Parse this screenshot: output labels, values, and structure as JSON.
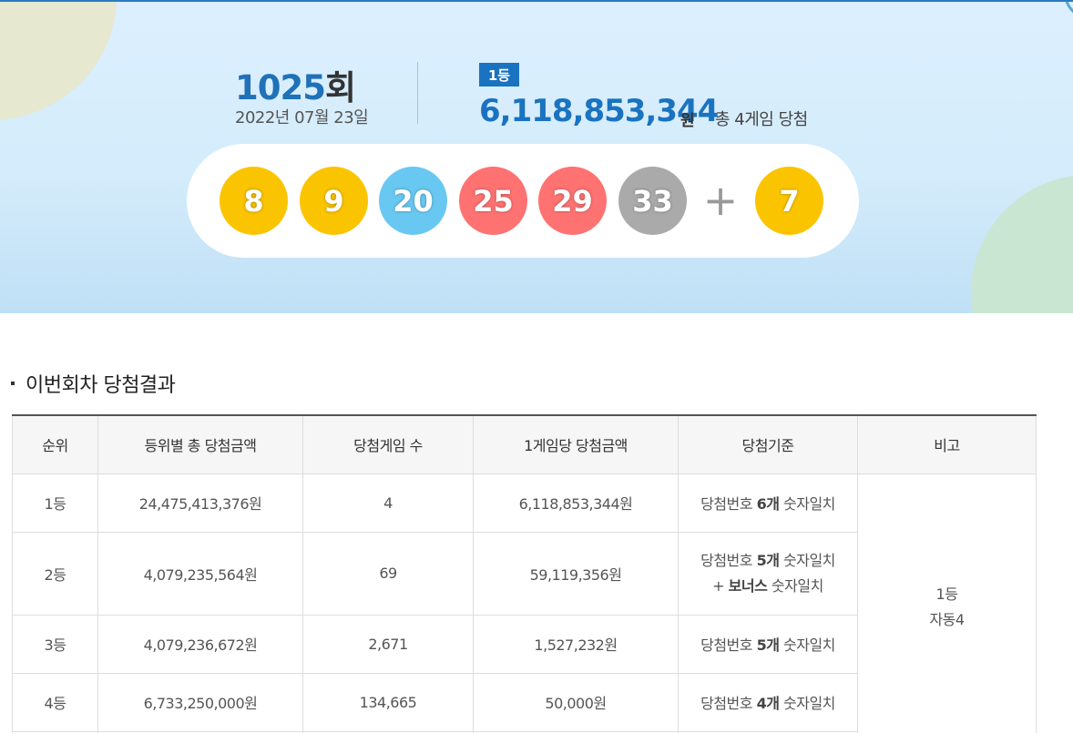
{
  "draw": {
    "number": "1025",
    "number_suffix": "회",
    "date": "2022년 07월 23일"
  },
  "first_prize": {
    "badge": "1등",
    "amount": "6,118,853,344",
    "unit": "원",
    "winners_text": "총 4게임 당첨"
  },
  "numbers": [
    {
      "value": "8",
      "color": "#fbc400"
    },
    {
      "value": "9",
      "color": "#fbc400"
    },
    {
      "value": "20",
      "color": "#69c8f2"
    },
    {
      "value": "25",
      "color": "#ff7272"
    },
    {
      "value": "29",
      "color": "#ff7272"
    },
    {
      "value": "33",
      "color": "#aaaaaa"
    }
  ],
  "plus_sign": "+",
  "bonus": {
    "value": "7",
    "color": "#fbc400"
  },
  "section_title": "이번회차 당첨결과",
  "table": {
    "headers": [
      "순위",
      "등위별 총 당첨금액",
      "당첨게임 수",
      "1게임당 당첨금액",
      "당첨기준",
      "비고"
    ],
    "rows": [
      {
        "rank": "1등",
        "total": "24,475,413,376원",
        "count": "4",
        "per_game": "6,118,853,344원",
        "criteria_a": "당첨번호 ",
        "criteria_b": "6개",
        "criteria_c": " 숫자일치"
      },
      {
        "rank": "2등",
        "total": "4,079,235,564원",
        "count": "69",
        "per_game": "59,119,356원",
        "criteria_a": "당첨번호 ",
        "criteria_b": "5개",
        "criteria_c": " 숫자일치",
        "criteria_d": "+ ",
        "criteria_e": "보너스",
        "criteria_f": " 숫자일치"
      },
      {
        "rank": "3등",
        "total": "4,079,236,672원",
        "count": "2,671",
        "per_game": "1,527,232원",
        "criteria_a": "당첨번호 ",
        "criteria_b": "5개",
        "criteria_c": " 숫자일치"
      },
      {
        "rank": "4등",
        "total": "6,733,250,000원",
        "count": "134,665",
        "per_game": "50,000원",
        "criteria_a": "당첨번호 ",
        "criteria_b": "4개",
        "criteria_c": " 숫자일치"
      }
    ],
    "note_line1": "1등",
    "note_line2": "자동4"
  }
}
